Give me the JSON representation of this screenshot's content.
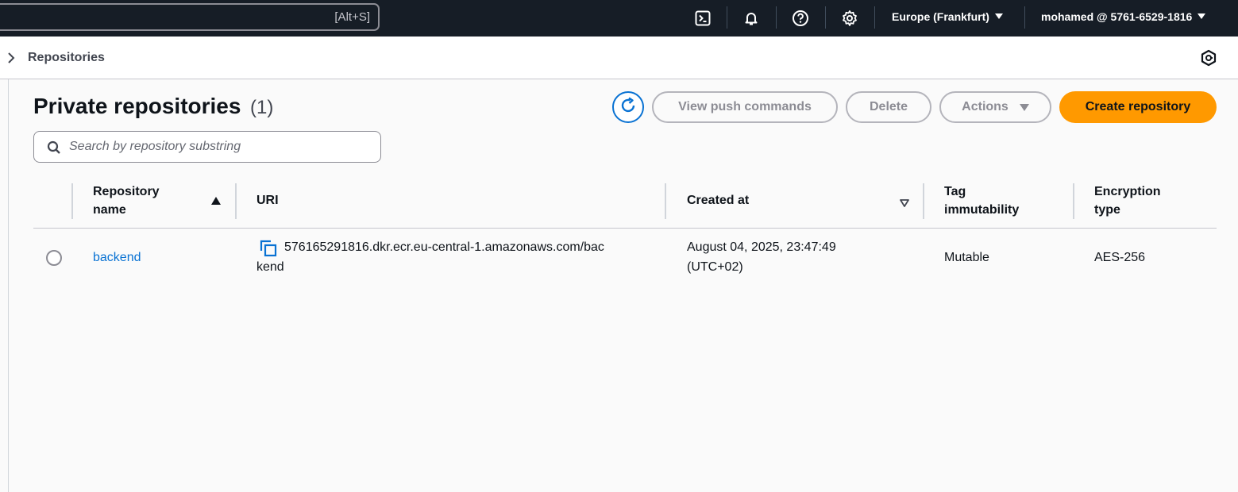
{
  "topbar": {
    "search_shortcut": "[Alt+S]",
    "icons": [
      "cloudshell-icon",
      "bell-icon",
      "help-icon",
      "gear-icon"
    ],
    "region": "Europe (Frankfurt)",
    "account": "mohamed @ 5761-6529-1816"
  },
  "breadcrumb": {
    "label": "Repositories"
  },
  "page": {
    "title": "Private repositories",
    "count": "(1)"
  },
  "actions": {
    "view_push_commands": "View push commands",
    "delete": "Delete",
    "actions": "Actions",
    "create_repository": "Create repository"
  },
  "filter": {
    "placeholder": "Search by repository substring"
  },
  "table": {
    "headers": {
      "name_line1": "Repository",
      "name_line2": "name",
      "uri": "URI",
      "created_at": "Created at",
      "tag_line1": "Tag",
      "tag_line2": "immutability",
      "enc_line1": "Encryption",
      "enc_line2": "type"
    },
    "rows": [
      {
        "name": "backend",
        "uri_line1": "576165291816.dkr.ecr.eu-central-1.amazonaws.com/bac",
        "uri_line2": "kend",
        "created_line1": "August 04, 2025, 23:47:49",
        "created_line2": "(UTC+02)",
        "tag_immutability": "Mutable",
        "encryption_type": "AES-256"
      }
    ]
  },
  "colors": {
    "topbar_bg": "#161d26",
    "primary": "#ff9900",
    "link": "#0972d3"
  }
}
